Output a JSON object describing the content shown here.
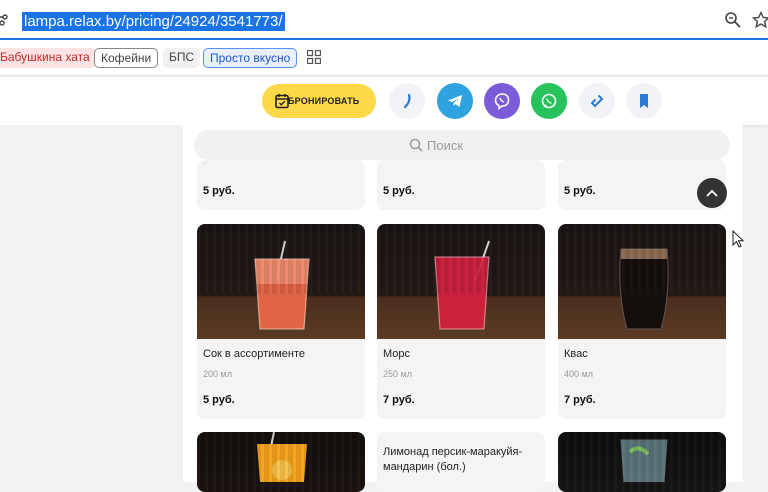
{
  "browser": {
    "url": "lampa.relax.by/pricing/24924/3541773/",
    "bookmarks": [
      "Бабушкина хата",
      "Кофейни",
      "БПС",
      "Просто вкусно"
    ]
  },
  "header": {
    "book_label": "БРОНИРОВАТЬ",
    "contacts": [
      "phone-icon",
      "telegram-icon",
      "viber-icon",
      "whatsapp-icon",
      "link-icon",
      "bookmark-icon"
    ],
    "colors": {
      "book": "#fdd94a",
      "telegram": "#2fa3e0",
      "viber": "#7a5cd9",
      "whatsapp": "#27c25c",
      "accent": "#2a7bd6"
    }
  },
  "search": {
    "placeholder": "Поиск"
  },
  "menu": {
    "row_top": {
      "prices": [
        "5 руб.",
        "5 руб.",
        "5 руб."
      ]
    },
    "items": [
      {
        "name": "Сок в ассортименте",
        "weight": "200 мл",
        "price": "5 руб."
      },
      {
        "name": "Морс",
        "weight": "250 мл",
        "price": "7 руб."
      },
      {
        "name": "Квас",
        "weight": "400 мл",
        "price": "7 руб."
      }
    ],
    "row_bottom": {
      "name_middle": "Лимонад персик-маракуйя-мандарин (бол.)"
    }
  }
}
